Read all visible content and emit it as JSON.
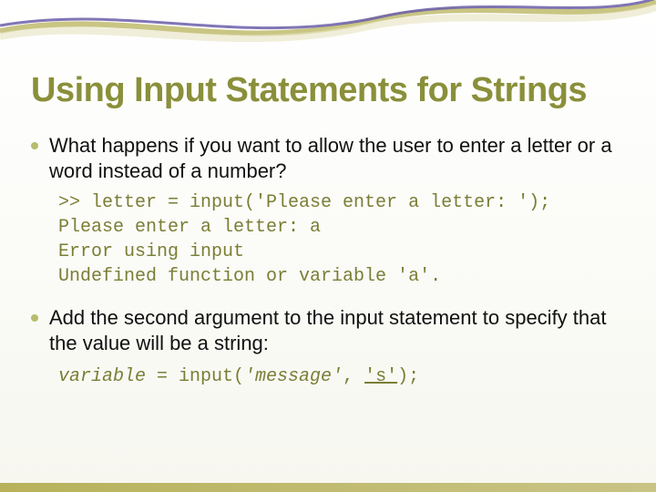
{
  "title": "Using Input Statements for Strings",
  "bullets": {
    "b1": "What happens if you want to allow the user to enter a letter or a word instead of a number?",
    "b2": "Add the second argument to the input statement to specify that the value will be a string:"
  },
  "code": {
    "l1": ">> letter = input('Please enter a letter: ');",
    "l2": "Please enter a letter: a",
    "l3": "Error using input",
    "l4": "Undefined function or variable 'a'."
  },
  "syntax": {
    "var": "variable",
    "eq_input": " = input(",
    "msg": "'message'",
    "comma": ", ",
    "sarg": "'s'",
    "close": ");"
  }
}
